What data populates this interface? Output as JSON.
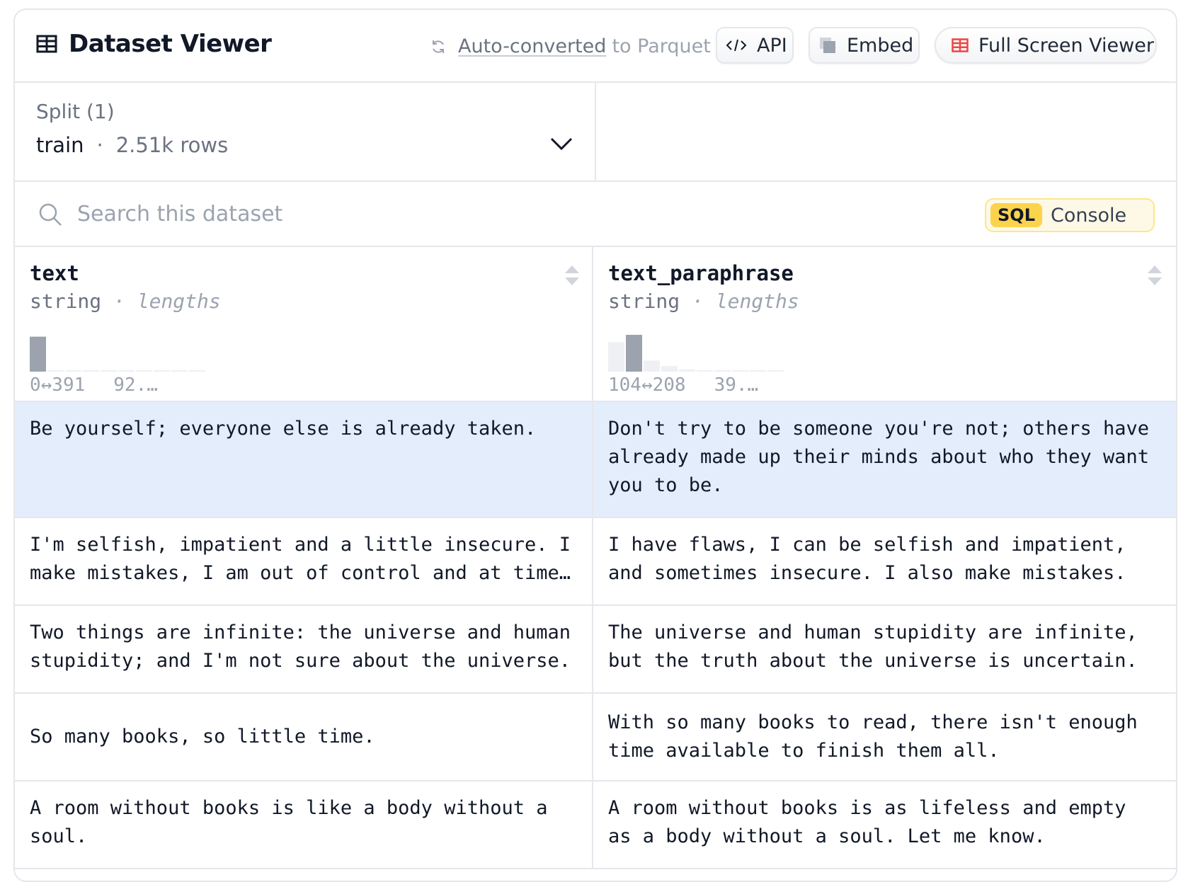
{
  "header": {
    "title": "Dataset Viewer",
    "auto_converted_link": "Auto-converted",
    "auto_converted_suffix": "to Parquet",
    "api_label": "API",
    "embed_label": "Embed",
    "full_screen_label": "Full Screen Viewer"
  },
  "split": {
    "label": "Split (1)",
    "name": "train",
    "separator": "·",
    "rows": "2.51k rows"
  },
  "search": {
    "placeholder": "Search this dataset",
    "sql_tag": "SQL",
    "sql_label": "Console"
  },
  "columns": [
    {
      "name": "text",
      "type": "string",
      "stat": "· lengths",
      "range_start": "0↔391",
      "range_end": "92.…",
      "histogram": [
        0.95,
        0.02,
        0.02,
        0.02,
        0.02,
        0.02,
        0.02,
        0.02,
        0.02,
        0.02
      ]
    },
    {
      "name": "text_paraphrase",
      "type": "string",
      "stat": "· lengths",
      "range_start": "104↔208",
      "range_end": "39.…",
      "histogram": [
        0.8,
        1.0,
        0.3,
        0.15,
        0.06,
        0.04,
        0.03,
        0.03,
        0.02,
        0.02
      ]
    }
  ],
  "rows": [
    {
      "text": "Be yourself; everyone else is already taken.",
      "text_paraphrase": "Don't try to be someone you're not; others have already made up their minds about who they want you to be."
    },
    {
      "text": "I'm selfish, impatient and a little insecure. I make mistakes, I am out of control and at times hard to handle.",
      "text_paraphrase": "I have flaws, I can be selfish and impatient, and sometimes insecure. I also make mistakes."
    },
    {
      "text": "Two things are infinite: the universe and human stupidity; and I'm not sure about the universe.",
      "text_paraphrase": "The universe and human stupidity are infinite, but the truth about the universe is uncertain."
    },
    {
      "text": "So many books, so little time.",
      "text_paraphrase": "With so many books to read, there isn't enough time available to finish them all."
    },
    {
      "text": "A room without books is like a body without a soul.",
      "text_paraphrase": "A room without books is as lifeless and empty as a body without a soul. Let me know."
    }
  ],
  "colors": {
    "selected_row": "#e3edfc",
    "border": "#e5e7eb",
    "sql_tag": "#fcd34d",
    "full_screen_icon": "#ef4444",
    "histogram_bar": "#9ca3af",
    "histogram_bar_light": "#eef0f3"
  },
  "icons": {
    "title": "table-grid-icon",
    "parquet": "sync-icon",
    "api": "code-icon",
    "embed": "copy-icon",
    "full_screen": "table-grid-icon",
    "split_dropdown": "chevron-down-icon",
    "search": "search-icon",
    "sort": "sort-icon"
  }
}
